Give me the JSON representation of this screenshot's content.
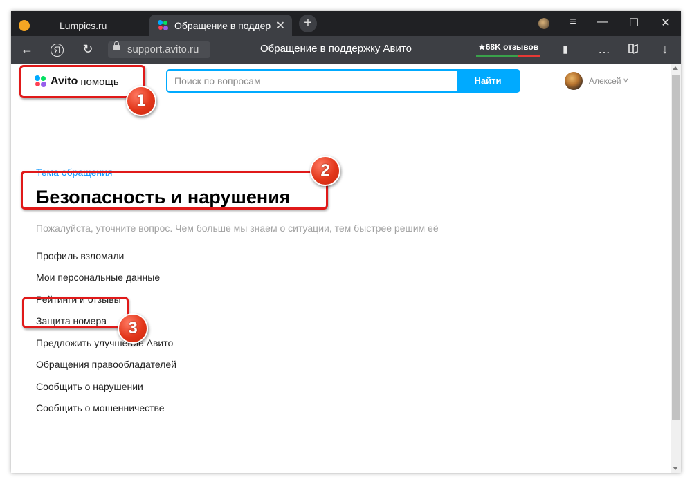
{
  "browser": {
    "tabs": [
      {
        "label": "Lumpics.ru",
        "active": false
      },
      {
        "label": "Обращение в поддерж",
        "active": true
      }
    ],
    "url": "support.avito.ru",
    "page_title": "Обращение в поддержку Авито",
    "reviews_badge": "★68K отзывов",
    "icons": {
      "back": "←",
      "yandex": "Я",
      "reload": "↻",
      "new_tab": "+",
      "menu": "≡",
      "minimize": "—",
      "maximize": "☐",
      "close": "✕",
      "bookmark": "▮",
      "more": "…",
      "download": "↓",
      "tab_close": "✕"
    }
  },
  "site": {
    "logo_word": "Avito",
    "logo_suffix": "помощь",
    "search": {
      "placeholder": "Поиск по вопросам",
      "button": "Найти"
    },
    "user": {
      "name": "Алексей ˅"
    }
  },
  "content": {
    "topic_link": "Тема обращения",
    "heading": "Безопасность и нарушения",
    "hint": "Пожалуйста, уточните вопрос. Чем больше мы знаем о ситуации, тем быстрее решим её",
    "options": [
      "Профиль взломали",
      "Мои персональные данные",
      "Рейтинги и отзывы",
      "Защита номера",
      "Предложить улучшение Авито",
      "Обращения правообладателей",
      "Сообщить о нарушении",
      "Сообщить о мошенничестве"
    ]
  },
  "annotations": [
    "1",
    "2",
    "3"
  ],
  "colors": {
    "accent": "#00aaff",
    "link": "#0a95ff",
    "highlight": "#e01919",
    "badge": "#e2361a",
    "browser_dark": "#202124",
    "browser_bar": "#3d3f44"
  }
}
